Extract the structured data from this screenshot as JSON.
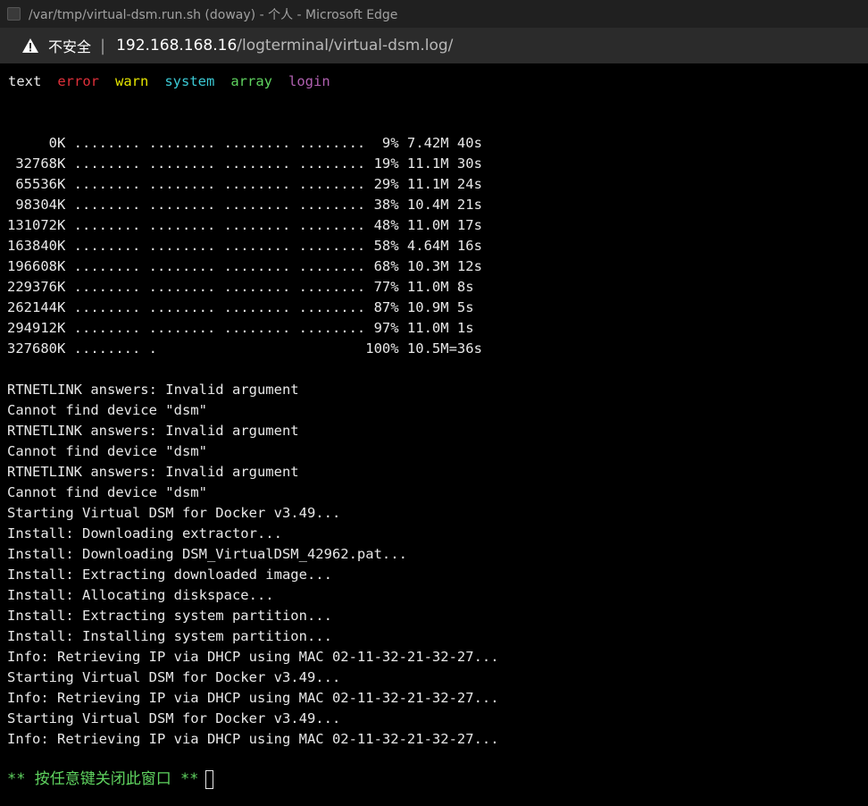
{
  "window": {
    "title": "/var/tmp/virtual-dsm.run.sh (doway) - 个人 - Microsoft Edge"
  },
  "addressbar": {
    "security_label": "不安全",
    "separator": "|",
    "url_host": "192.168.168.16",
    "url_path": "/logterminal/virtual-dsm.log/"
  },
  "filters": [
    {
      "label": "text",
      "color": "#e8e8e8"
    },
    {
      "label": "error",
      "color": "#e0303a"
    },
    {
      "label": "warn",
      "color": "#e6e600"
    },
    {
      "label": "system",
      "color": "#3bc9d4"
    },
    {
      "label": "array",
      "color": "#5fd35f"
    },
    {
      "label": "login",
      "color": "#b060b0"
    }
  ],
  "log_lines": [
    "     0K ........ ........ ........ ........  9% 7.42M 40s",
    " 32768K ........ ........ ........ ........ 19% 11.1M 30s",
    " 65536K ........ ........ ........ ........ 29% 11.1M 24s",
    " 98304K ........ ........ ........ ........ 38% 10.4M 21s",
    "131072K ........ ........ ........ ........ 48% 11.0M 17s",
    "163840K ........ ........ ........ ........ 58% 4.64M 16s",
    "196608K ........ ........ ........ ........ 68% 10.3M 12s",
    "229376K ........ ........ ........ ........ 77% 11.0M 8s",
    "262144K ........ ........ ........ ........ 87% 10.9M 5s",
    "294912K ........ ........ ........ ........ 97% 11.0M 1s",
    "327680K ........ .                         100% 10.5M=36s",
    "",
    "RTNETLINK answers: Invalid argument",
    "Cannot find device \"dsm\"",
    "RTNETLINK answers: Invalid argument",
    "Cannot find device \"dsm\"",
    "RTNETLINK answers: Invalid argument",
    "Cannot find device \"dsm\"",
    "Starting Virtual DSM for Docker v3.49...",
    "Install: Downloading extractor...",
    "Install: Downloading DSM_VirtualDSM_42962.pat...",
    "Install: Extracting downloaded image...",
    "Install: Allocating diskspace...",
    "Install: Extracting system partition...",
    "Install: Installing system partition...",
    "Info: Retrieving IP via DHCP using MAC 02-11-32-21-32-27...",
    "Starting Virtual DSM for Docker v3.49...",
    "Info: Retrieving IP via DHCP using MAC 02-11-32-21-32-27...",
    "Starting Virtual DSM for Docker v3.49...",
    "Info: Retrieving IP via DHCP using MAC 02-11-32-21-32-27..."
  ],
  "prompt": {
    "text": "** 按任意键关闭此窗口 **"
  },
  "icons": {
    "app": "app-icon",
    "security": "warning-icon",
    "cursor": "cursor-block"
  }
}
